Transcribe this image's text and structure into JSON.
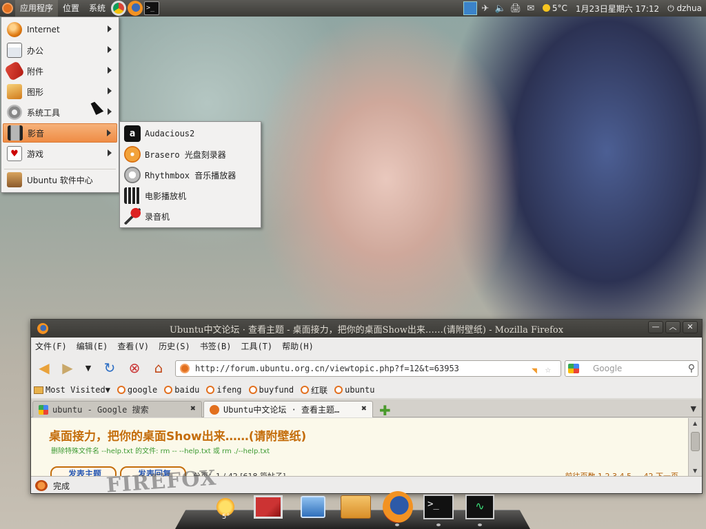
{
  "top_panel": {
    "menus": [
      "应用程序",
      "位置",
      "系统"
    ],
    "launchers": [
      "chrome-icon",
      "firefox-icon",
      "terminal-icon"
    ],
    "tray_icons": [
      "dropbox-icon",
      "network-icon",
      "volume-icon",
      "printer-icon",
      "mail-icon"
    ],
    "weather": "5°C",
    "clock": "1月23日星期六 17:12",
    "user": "dzhua"
  },
  "app_menu": {
    "items": [
      {
        "label": "Internet",
        "icon": "internet-icon",
        "has_submenu": true
      },
      {
        "label": "办公",
        "icon": "office-icon",
        "has_submenu": true
      },
      {
        "label": "附件",
        "icon": "accessories-icon",
        "has_submenu": true
      },
      {
        "label": "图形",
        "icon": "graphics-icon",
        "has_submenu": true
      },
      {
        "label": "系统工具",
        "icon": "system-tools-icon",
        "has_submenu": true
      },
      {
        "label": "影音",
        "icon": "sound-video-icon",
        "has_submenu": true,
        "highlighted": true
      },
      {
        "label": "游戏",
        "icon": "games-icon",
        "has_submenu": true
      },
      {
        "label": "Ubuntu 软件中心",
        "icon": "software-center-icon",
        "has_submenu": false
      }
    ]
  },
  "media_submenu": {
    "items": [
      {
        "label": "Audacious2",
        "icon": "audacious-icon"
      },
      {
        "label": "Brasero 光盘刻录器",
        "icon": "brasero-icon"
      },
      {
        "label": "Rhythmbox 音乐播放器",
        "icon": "rhythmbox-icon"
      },
      {
        "label": "电影播放机",
        "icon": "movie-player-icon"
      },
      {
        "label": "录音机",
        "icon": "sound-recorder-icon"
      }
    ]
  },
  "firefox": {
    "title": "Ubuntu中文论坛 · 查看主题 - 桌面接力，把你的桌面Show出来……(请附壁纸) - Mozilla Firefox",
    "menubar": [
      "文件(F)",
      "编辑(E)",
      "查看(V)",
      "历史(S)",
      "书签(B)",
      "工具(T)",
      "帮助(H)"
    ],
    "url": "http://forum.ubuntu.org.cn/viewtopic.php?f=12&t=63953",
    "search_placeholder": "Google",
    "bookmarks": [
      "Most Visited▼",
      "google",
      "baidu",
      "ifeng",
      "buyfund",
      "红联",
      "ubuntu"
    ],
    "tabs": [
      {
        "label": "ubuntu - Google 搜索",
        "active": false
      },
      {
        "label": "Ubuntu中文论坛 · 查看主题…",
        "active": true
      }
    ],
    "content": {
      "topic_title": "桌面接力，把你的桌面Show出来……(请附壁纸)",
      "tip": "删除特殊文件名 --help.txt 的文件: rm -- --help.txt 或 rm ./--help.txt",
      "post_button": "发表主题",
      "reply_button": "发表回复",
      "pager": "分页：1 / 42  [618 篇帖子]",
      "pager_right": "前往页数 1 2 3 4 5 ... 42  下一页"
    },
    "status": "完成",
    "watermark": "FIREFOX"
  },
  "dock": {
    "items": [
      "weather-sun-icon",
      "impress-icon",
      "uploader-icon",
      "folder-icon",
      "firefox-icon",
      "terminal-icon",
      "system-monitor-icon"
    ],
    "weather_label": "5°"
  },
  "colors": {
    "menu_highlight": "#ef8c45",
    "title_orange": "#c46d0b",
    "tip_green": "#3d9a32",
    "panel_dark": "#3c3b37"
  }
}
